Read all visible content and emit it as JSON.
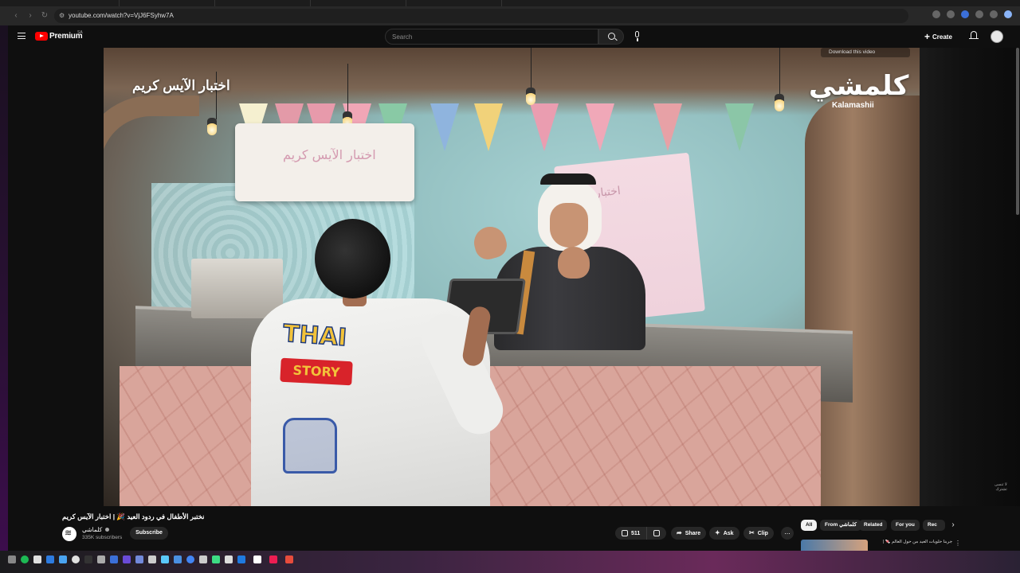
{
  "browser": {
    "url": "youtube.com/watch?v=VjJ6FSyhw7A",
    "tabs": [
      "",
      "",
      "",
      "",
      "",
      "",
      "",
      "",
      "",
      ""
    ]
  },
  "header": {
    "brand": "Premium",
    "region": "SA",
    "search_placeholder": "Search",
    "create_label": "Create"
  },
  "video": {
    "overlay_title": "اختبار الآيس كريم",
    "channel_logo_ar": "كلمشي",
    "channel_logo_en": "Kalamashii",
    "download_hint": "Download this video",
    "shirt_text_1": "THAI",
    "shirt_text_2": "STORY",
    "ac_logo": "اختبار الآيس كريم",
    "board_logo": "اختبار"
  },
  "below": {
    "title": "نختبر الأطفال في ردود العيد 🎉 | اختبار الآيس كريم",
    "channel_name": "كلماشي",
    "subscribers": "335K subscribers",
    "subscribe_label": "Subscribe",
    "likes": "511",
    "share_label": "Share",
    "ask_label": "Ask",
    "clip_label": "Clip",
    "more_label": "..."
  },
  "chips": [
    {
      "label": "All",
      "active": true
    },
    {
      "label": "From كلماشي",
      "active": false
    },
    {
      "label": "Related",
      "active": false
    },
    {
      "label": "For you",
      "active": false
    },
    {
      "label": "Rec",
      "active": false
    }
  ],
  "recommendation": {
    "title": "جربنا حلويات العيد من حول العالم 🍬 |"
  },
  "corner_text": "لا تنسى\nتشترك",
  "icons": {
    "menu": "hamburger-icon",
    "search": "search-icon",
    "mic": "mic-icon",
    "bell": "bell-icon",
    "like": "thumbs-up-icon",
    "dislike": "thumbs-down-icon",
    "share": "share-icon",
    "ask": "sparkle-icon",
    "clip": "scissors-icon"
  },
  "colors": {
    "brand_red": "#ff0000",
    "background": "#0f0f0f",
    "pill": "#272727"
  }
}
